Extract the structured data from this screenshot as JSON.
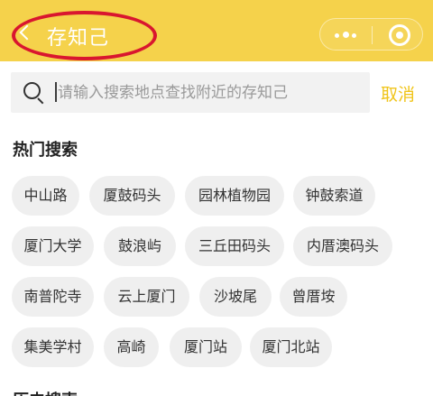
{
  "header": {
    "title": "存知己",
    "back_icon": "chevron-left-icon",
    "more_icon": "more-dots-icon",
    "close_icon": "target-circle-icon",
    "background_color": "#f5d24b",
    "highlight_color": "#d9162f"
  },
  "search": {
    "placeholder": "请输入搜索地点查找附近的存知己",
    "value": "",
    "cancel_label": "取消"
  },
  "hot_search": {
    "title": "热门搜索",
    "tags": [
      "中山路",
      "厦鼓码头",
      "园林植物园",
      "钟鼓索道",
      "厦门大学",
      "鼓浪屿",
      "三丘田码头",
      "内厝澳码头",
      "南普陀寺",
      "云上厦门",
      "沙坡尾",
      "曾厝垵",
      "集美学村",
      "高崎",
      "厦门站",
      "厦门北站"
    ]
  },
  "next_section": {
    "title": "历史搜索"
  }
}
